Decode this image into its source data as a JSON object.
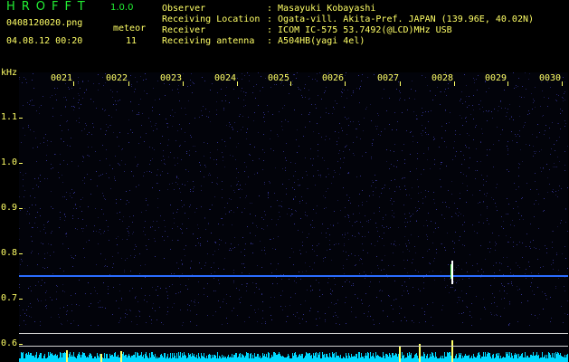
{
  "app": {
    "title": "HROFFT",
    "version": "1.0.0"
  },
  "file": {
    "name": "0408120020.png",
    "datetime": "04.08.12 00:20"
  },
  "meteor": {
    "label": "meteor",
    "count": "11"
  },
  "station": [
    {
      "key": "Observer",
      "value": ": Masayuki Kobayashi"
    },
    {
      "key": "Receiving Location",
      "value": ": Ogata-vill. Akita-Pref. JAPAN (139.96E, 40.02N)"
    },
    {
      "key": "Receiver",
      "value": ": ICOM IC-575 53.7492(@LCD)MHz USB"
    },
    {
      "key": "Receiving antenna",
      "value": ": A504HB(yagi 4el)"
    }
  ],
  "axis": {
    "y_unit": "kHz",
    "y_ticks": [
      "1.1",
      "1.0",
      "0.9",
      "0.8",
      "0.7",
      "0.6"
    ],
    "x_ticks": [
      "0021",
      "0022",
      "0023",
      "0024",
      "0025",
      "0026",
      "0027",
      "0028",
      "0029",
      "0030"
    ]
  },
  "colors": {
    "label": "#ffff66",
    "title": "#22ee33",
    "carrier": "#2a6cff",
    "spectrum": "#00d8ff",
    "echo": "#ffff66"
  }
}
